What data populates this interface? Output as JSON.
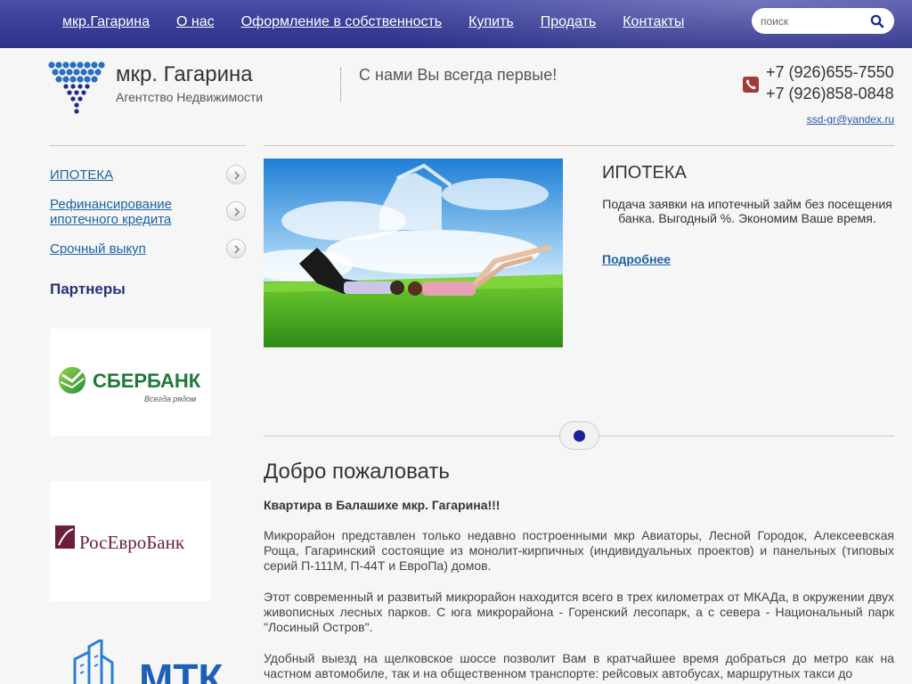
{
  "nav": {
    "items": [
      {
        "label": "мкр.Гагарина"
      },
      {
        "label": "О нас"
      },
      {
        "label": "Оформление в собственность"
      },
      {
        "label": "Купить"
      },
      {
        "label": "Продать"
      },
      {
        "label": "Контакты"
      }
    ],
    "search_placeholder": "поиск"
  },
  "header": {
    "title": "мкр. Гагарина",
    "subtitle": "Агентство Недвижимости",
    "slogan": "С нами Вы всегда первые!",
    "phones": [
      "+7 (926)655-7550",
      "+7 (926)858-0848"
    ],
    "email": "ssd-gr@yandex.ru"
  },
  "sidebar": {
    "items": [
      {
        "label": "ИПОТЕКА"
      },
      {
        "label": "Рефинансирование ипотечного кредита"
      },
      {
        "label": "Срочный выкуп"
      }
    ],
    "partners_title": "Партнеры",
    "partners": [
      {
        "name": "СБЕРБАНК",
        "tagline": "Всегда рядом"
      },
      {
        "name": "РосЕвроБанк"
      },
      {
        "name": "МТК"
      }
    ]
  },
  "slider": {
    "title": "ИПОТЕКА",
    "text": "Подача заявки на ипотечный займ без посещения банка. Выгодный %. Экономим Ваше время.",
    "more_label": "Подробнее",
    "slide_count": 1,
    "active_slide": 1
  },
  "content": {
    "title": "Добро пожаловать",
    "intro": "Квартира в Балашихе мкр. Гагарина!!!",
    "paragraphs": [
      "Микрорайон представлен только недавно построенными мкр Авиаторы, Лесной Городок, Алексеевская Роща, Гагаринский состоящие из монолит-кирпичных (индивидуальных проектов) и панельных  (типовых серий П-111М, П-44Т и ЕвроПа) домов.",
      "Этот современный и развитый микрорайон находится всего в трех километрах от МКАДа, в окружении двух живописных лесных парков. С юга микрорайона - Горенский лесопарк, а с севера - Национальный парк \"Лосиный Остров\".",
      "Удобный выезд на щелковское шоссе позволит Вам в кратчайшее время добраться до метро как на частном автомобиле, так и на общественном транспорте: рейсовых автобусах, маршрутных такси до"
    ]
  },
  "colors": {
    "nav_bg": "#3b3f99",
    "link": "#1e62a8",
    "partners_heading": "#2a2f7a",
    "slider_dot": "#1a239a",
    "phone_icon": "#a33a3a"
  },
  "icons": {
    "search": "magnifier-icon",
    "phone": "phone-icon",
    "arrow": "chevron-right-icon",
    "logo": "dot-triangle-logo"
  }
}
